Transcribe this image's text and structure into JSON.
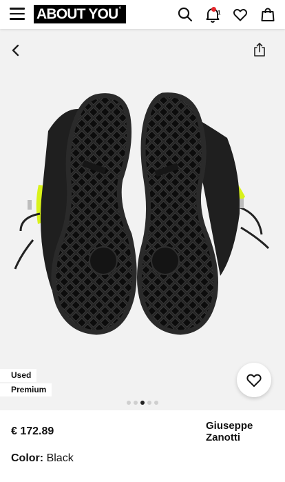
{
  "header": {
    "logo": "ABOUT YOU",
    "logo_mark": "°",
    "notification_count": "1",
    "icons": [
      "menu-icon",
      "search-icon",
      "bell-icon",
      "heart-icon",
      "bag-icon"
    ]
  },
  "gallery": {
    "badges": [
      "Used",
      "Premium"
    ],
    "dots_total": 5,
    "dots_active_index": 2,
    "icons": [
      "chevron-left-icon",
      "share-icon",
      "heart-icon"
    ]
  },
  "product": {
    "price": "€ 172.89",
    "brand": "Giuseppe Zanotti",
    "color_label": "Color:",
    "color_value": "Black"
  },
  "colors": {
    "accent_yellow": "#d9f21a",
    "notification_dot": "#e4282d",
    "gallery_bg": "#f2f2f2"
  }
}
